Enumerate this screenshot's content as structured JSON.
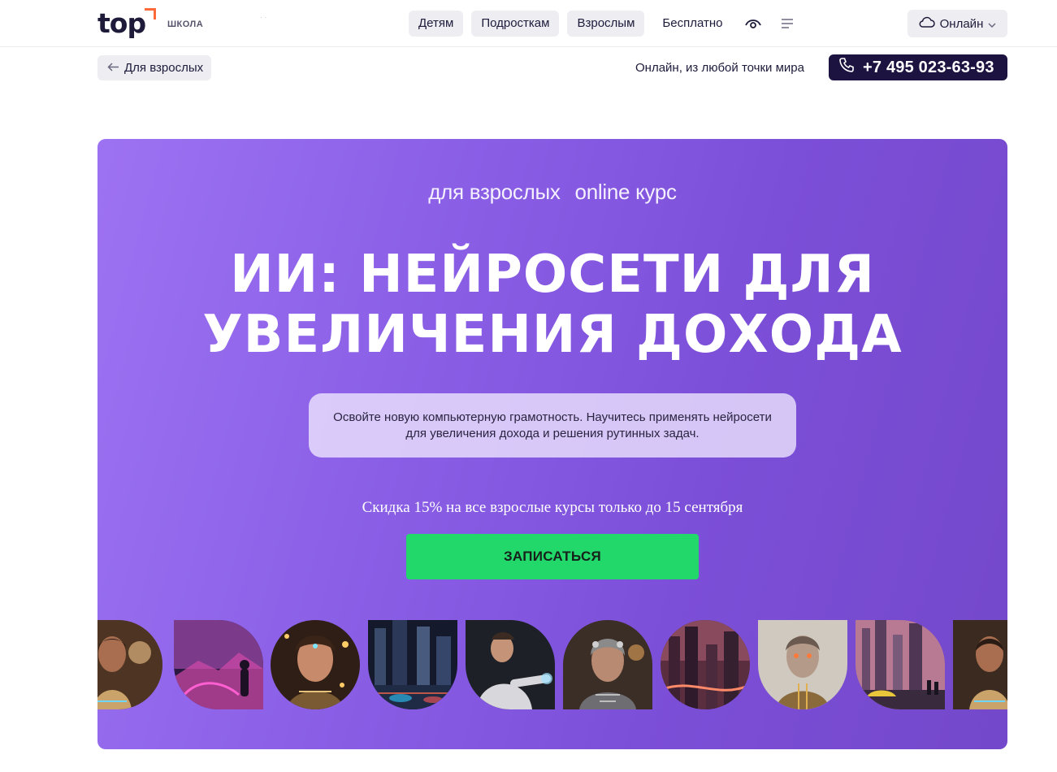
{
  "header": {
    "logo_text": "top",
    "logo_sub": "ШКОЛА",
    "nav": [
      "Детям",
      "Подросткам",
      "Взрослым"
    ],
    "nav_free": "Бесплатно",
    "eye_icon": "eye-icon",
    "menu_icon": "menu-icon",
    "format_select": "Онлайн",
    "accent_color": "#ff6a3d"
  },
  "subheader": {
    "back_label": "Для взрослых",
    "location": "Онлайн, из любой точки мира",
    "phone": "+7 495 023-63-93"
  },
  "hero": {
    "tag_audience": "для взрослых",
    "tag_format": "online курс",
    "title_line1": "ИИ: НЕЙРОСЕТИ ДЛЯ",
    "title_line2": "УВЕЛИЧЕНИЯ ДОХОДА",
    "description": "Освойте новую компьютерную грамотность. Научитесь применять нейросети для увеличения дохода и решения рутинных задач.",
    "promo": "Скидка 15% на все взрослые курсы только до 15 сентября",
    "cta_label": "ЗАПИСАТЬСЯ",
    "cta_color": "#22d86b",
    "background_color": "#8a5fe6"
  },
  "gallery": [
    {
      "name": "ai-woman-portrait-image",
      "shape": "shape-pill-r"
    },
    {
      "name": "neon-city-figure-image",
      "shape": "shape-leaf"
    },
    {
      "name": "cyborg-woman-face-image",
      "shape": "shape-circle"
    },
    {
      "name": "night-city-street-image",
      "shape": "shape-archb"
    },
    {
      "name": "man-gesture-hologram-image",
      "shape": "shape-leaf"
    },
    {
      "name": "robot-woman-image",
      "shape": "shape-arch"
    },
    {
      "name": "futuristic-skyline-image",
      "shape": "shape-circle"
    },
    {
      "name": "android-portrait-image",
      "shape": "shape-archb"
    },
    {
      "name": "city-car-image",
      "shape": "shape-leaf"
    },
    {
      "name": "ai-woman-portrait-image",
      "shape": "shape-rect"
    }
  ]
}
